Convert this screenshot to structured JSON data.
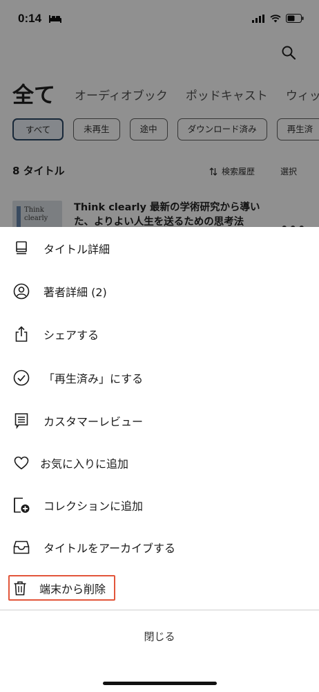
{
  "status_bar": {
    "time": "0:14"
  },
  "library": {
    "title": "全て",
    "tabs": [
      "オーディオブック",
      "ポッドキャスト",
      "ウィッ"
    ],
    "filters": [
      "すべて",
      "未再生",
      "途中",
      "ダウンロード済み",
      "再生済"
    ],
    "active_filter": "すべて",
    "title_count": "8 タイトル",
    "sort_label": "検索履歴",
    "select_label": "選択",
    "book": {
      "cover_text": "Think clearly",
      "title": "Think clearly 最新の学術研究から導いた、よりよい人生を送るための思考法"
    }
  },
  "sheet": {
    "items": [
      {
        "label": "タイトル詳細",
        "icon": "book-icon"
      },
      {
        "label": "著者詳細 (2)",
        "icon": "person-circle-icon"
      },
      {
        "label": "シェアする",
        "icon": "share-icon"
      },
      {
        "label": "「再生済み」にする",
        "icon": "check-circle-icon"
      },
      {
        "label": "カスタマーレビュー",
        "icon": "review-icon"
      },
      {
        "label": "お気に入りに追加",
        "icon": "heart-icon"
      },
      {
        "label": "コレクションに追加",
        "icon": "add-collection-icon"
      },
      {
        "label": "タイトルをアーカイブする",
        "icon": "archive-icon"
      },
      {
        "label": "端末から削除",
        "icon": "trash-icon"
      }
    ],
    "close_label": "閉じる",
    "highlight_color": "#e2553a"
  }
}
